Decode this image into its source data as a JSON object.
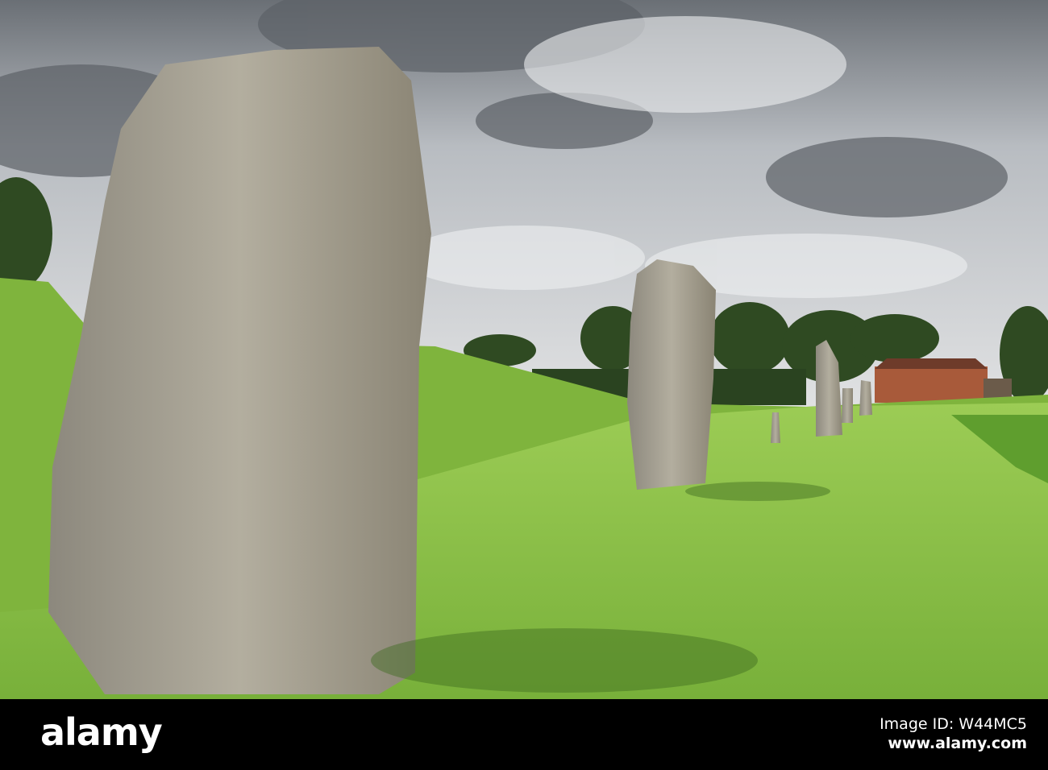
{
  "watermark": {
    "logo": "alamy",
    "image_id": "Image ID: W44MC5",
    "url": "www.alamy.com"
  },
  "colors": {
    "sky": "#c9ccd0",
    "cloud_dark": "#5c6167",
    "grass": "#8fc54a",
    "stone": "#a7a294",
    "footer": "#000000"
  }
}
